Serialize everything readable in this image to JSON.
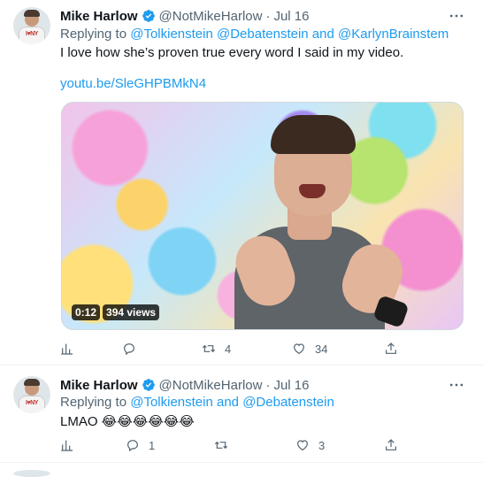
{
  "tweets": [
    {
      "name": "Mike Harlow",
      "handle": "@NotMikeHarlow",
      "dot": "·",
      "date": "Jul 16",
      "replying_prefix": "Replying to",
      "replying_to": [
        "@Tolkienstein",
        "@Debatenstein"
      ],
      "replying_and": "and",
      "replying_last": "@KarlynBrainstem",
      "text": "I love how she’s proven true every word I said in my video.",
      "link": "youtu.be/SleGHPBMkN4",
      "video": {
        "duration": "0:12",
        "views": "394 views"
      },
      "actions": {
        "replies": "",
        "retweets": "4",
        "likes": "34"
      }
    },
    {
      "name": "Mike Harlow",
      "handle": "@NotMikeHarlow",
      "dot": "·",
      "date": "Jul 16",
      "replying_prefix": "Replying to",
      "replying_first": "@Tolkienstein",
      "replying_and": "and",
      "replying_last": "@Debatenstein",
      "text": "LMAO 😂😂😂😂😂😂",
      "actions": {
        "replies": "1",
        "retweets": "",
        "likes": "3"
      }
    }
  ],
  "icons": {
    "verified": "verified-badge-icon",
    "more": "more-icon",
    "analytics": "analytics-icon",
    "reply": "reply-icon",
    "retweet": "retweet-icon",
    "like": "like-icon",
    "share": "share-icon"
  },
  "colors": {
    "accent": "#1d9bf0",
    "muted": "#536471",
    "text": "#0f1419"
  }
}
